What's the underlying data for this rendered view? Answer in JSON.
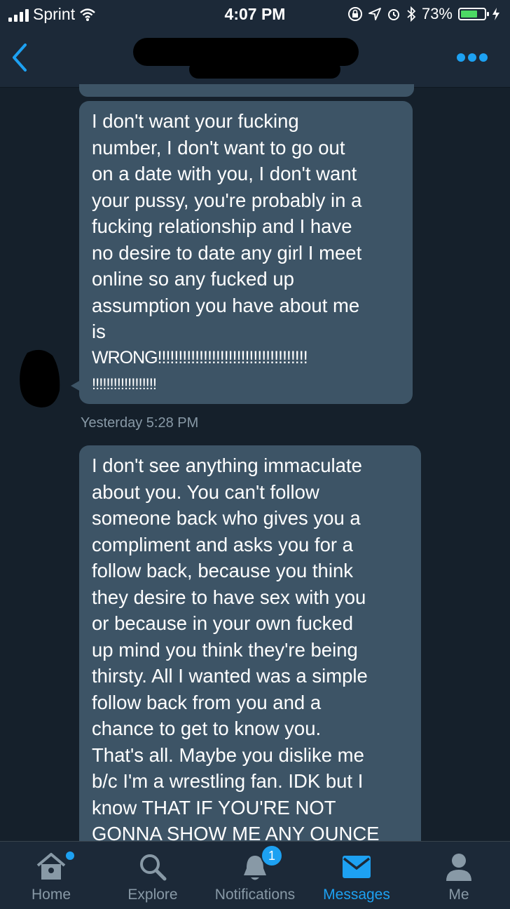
{
  "status_bar": {
    "carrier": "Sprint",
    "time": "4:07 PM",
    "battery_percent": "73%",
    "battery_level": 0.73,
    "icons": [
      "signal-icon",
      "wifi-icon",
      "lock-rotation-icon",
      "location-icon",
      "alarm-icon",
      "bluetooth-icon",
      "battery-icon",
      "charging-icon"
    ]
  },
  "header": {
    "back_icon": "chevron-left-icon",
    "more_icon": "more-dots-icon"
  },
  "messages": [
    {
      "lines": [
        "I don't want your fucking",
        "number, I don't want to go out",
        "on a date with you, I don't want",
        "your pussy, you're probably in a",
        "fucking relationship and I have",
        "no desire to date any girl I meet",
        "online so any fucked up",
        "assumption you have about me",
        "is",
        "WRONG!!!!!!!!!!!!!!!!!!!!!!!!!!!!!!!!!!!!",
        "!!!!!!!!!!!!!!!!!!"
      ]
    },
    {
      "lines": [
        "I don't see anything immaculate",
        "about you. You can't follow",
        "someone back who gives you a",
        "compliment and asks you for a",
        "follow back, because you think",
        "they desire to have sex with you",
        "or because in your own fucked",
        "up mind you think they're being",
        "thirsty. All I wanted was a simple",
        "follow back from you and a",
        "chance to get to know you.",
        "That's all. Maybe you dislike me",
        "b/c I'm a wrestling fan. IDK but I",
        "know THAT IF YOU'RE NOT",
        "GONNA SHOW ME ANY OUNCE"
      ]
    }
  ],
  "timestamp": "Yesterday 5:28 PM",
  "tabs": [
    {
      "label": "Home",
      "icon": "home-icon",
      "active": false
    },
    {
      "label": "Explore",
      "icon": "search-icon",
      "active": false
    },
    {
      "label": "Notifications",
      "icon": "bell-icon",
      "active": false,
      "badge": "1"
    },
    {
      "label": "Messages",
      "icon": "envelope-icon",
      "active": true
    },
    {
      "label": "Me",
      "icon": "person-icon",
      "active": false
    }
  ],
  "colors": {
    "background": "#15202b",
    "bubble": "#3d5466",
    "accent": "#1da1f2",
    "muted_text": "#8899a6"
  }
}
